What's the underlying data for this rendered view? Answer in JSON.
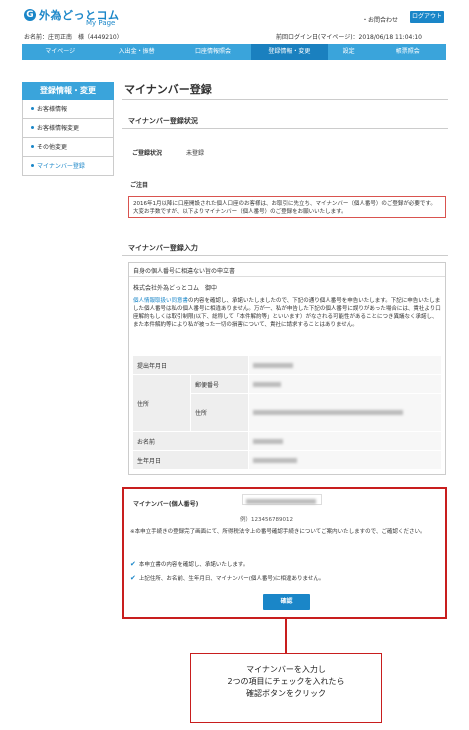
{
  "header": {
    "logo_mark": "G",
    "logo_text": "外為どっとコム",
    "logo_sub": "My Page",
    "contact": "・お問合わせ",
    "logout": "ログアウト",
    "user_name": "お名前：庄司正南　様（4449210）",
    "last_login": "前回ログイン日(マイページ)：2018/06/18 11:04:10"
  },
  "nav": [
    "マイページ",
    "入出金・振替",
    "口座情報照会",
    "登録情報・変更",
    "設定",
    "帳票照会"
  ],
  "sidebar": {
    "title": "登録情報・変更",
    "items": [
      "お客様情報",
      "お客様情報変更",
      "その他変更",
      "マイナンバー登録"
    ]
  },
  "main": {
    "title": "マイナンバー登録",
    "status_section": "マイナンバー登録状況",
    "status_label": "ご登録状況",
    "status_value": "未登録",
    "attention_title": "ご注目",
    "attention_text": "2016年1月以降に口座開設された個人口座のお客様は、お取引に先立ち、マイナンバー（個人番号）のご登録が必要です。大変お手数ですが、以下よりマイナンバー（個人番号）のご登録をお願いいたします。",
    "input_section": "マイナンバー登録入力",
    "apply_header": "自身の個人番号に相違ない旨の申立書",
    "apply_to": "株式会社外為どっとコム　御中",
    "apply_link": "個人情報取扱い同意書",
    "apply_text": "の内容を確認し、承諾いたしましたので、下記の通り個人番号を申告いたします。下記に申告いたしました個人番号は私の個人番号に相違ありません。万が一、私が申告した下記の個人番号に誤りがあった場合には、貴社より口座解約もしくは取引制限(以下、総称して「本件解約等」といいます）がなされる可能性があることにつき異議なく承諾し、また本件解約等により私が被った一切の損害について、貴社に請求することはありません。",
    "table": {
      "submit_date": "提出年月日",
      "address": "住所",
      "postal_code": "郵便番号",
      "address_sub": "住所",
      "name": "お名前",
      "birth": "生年月日"
    }
  },
  "input_area": {
    "mn_label": "マイナンバー(個人番号)",
    "example": "例）123456789012",
    "note": "※本申立手続きの登録完了画面にて、所得税法令上の番号確認手続きについてご案内いたしますので、ご確認ください。",
    "check1": "本申立書の内容を確認し、承諾いたします。",
    "check2": "上記住所、お名前、生年月日、マイナンバー(個人番号)に相違ありません。",
    "confirm": "確認"
  },
  "callout": {
    "line1": "マイナンバーを入力し",
    "line2": "2つの項目にチェックを入れたら",
    "line3": "確認ボタンをクリック"
  },
  "colors": {
    "brand": "#1a86c8",
    "nav": "#3aa4db",
    "highlight": "#c81e1e"
  }
}
